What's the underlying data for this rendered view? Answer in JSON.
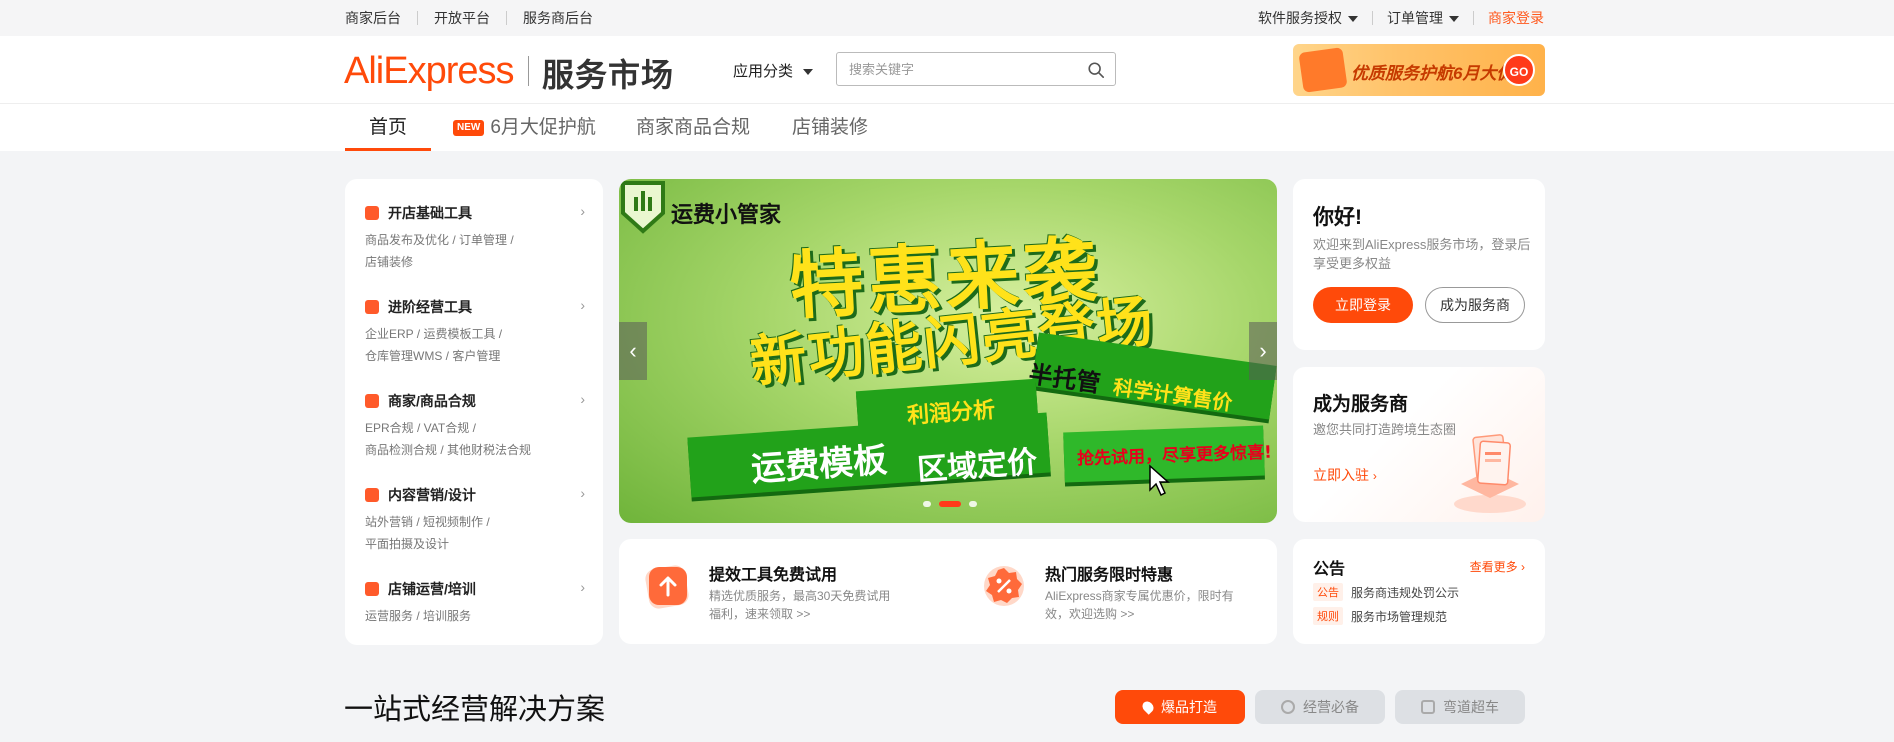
{
  "topbar": {
    "left_links": [
      "商家后台",
      "开放平台",
      "服务商后台"
    ],
    "software_auth": "软件服务授权",
    "order_mgmt": "订单管理",
    "merchant_login": "商家登录"
  },
  "header": {
    "logo_brand": "AliExpress",
    "logo_service": "服务市场",
    "category_dropdown": "应用分类",
    "search_placeholder": "搜索关键字",
    "promo_text": "优质服务护航6月大促",
    "promo_go": "GO"
  },
  "nav": {
    "tabs": [
      {
        "label": "首页",
        "active": true
      },
      {
        "label": "6月大促护航",
        "badge": "NEW"
      },
      {
        "label": "商家商品合规"
      },
      {
        "label": "店铺装修"
      }
    ]
  },
  "categories": [
    {
      "title": "开店基础工具",
      "icon": "shop-icon",
      "sub_line1": "商品发布及优化 / 订单管理 /",
      "sub_line2": "店铺装修"
    },
    {
      "title": "进阶经营工具",
      "icon": "clipboard-icon",
      "sub_line1": "企业ERP / 运费模板工具 /",
      "sub_line2": "仓库管理WMS / 客户管理"
    },
    {
      "title": "商家/商品合规",
      "icon": "diamond-icon",
      "sub_line1": "EPR合规 / VAT合规 /",
      "sub_line2": "商品检测合规 / 其他财税法合规"
    },
    {
      "title": "内容营销/设计",
      "icon": "brush-icon",
      "sub_line1": "站外营销 / 短视频制作 /",
      "sub_line2": "平面拍摄及设计"
    },
    {
      "title": "店铺运营/培训",
      "icon": "trend-icon",
      "sub_line1": "运营服务 / 培训服务",
      "sub_line2": ""
    }
  ],
  "carousel": {
    "brand": "运费小管家",
    "headline1": "特惠来袭",
    "headline2": "新功能闪亮登场",
    "tag_half": "半托管",
    "tag_sci": "科学计算售价",
    "tag_profit": "利润分析",
    "tag_freight": "运费模板",
    "tag_region": "区域定价",
    "tag_trial": "抢先试用，尽享更多惊喜!",
    "prev_arrow": "‹",
    "next_arrow": "›"
  },
  "hello_card": {
    "title": "你好!",
    "desc": "欢迎来到AliExpress服务市场，登录后享受更多权益",
    "login_btn": "立即登录",
    "provider_btn": "成为服务商"
  },
  "become_card": {
    "title": "成为服务商",
    "desc": "邀您共同打造跨境生态圈",
    "link": "立即入驻"
  },
  "features": [
    {
      "title": "提效工具免费试用",
      "desc": "精选优质服务，最高30天免费试用福利，速来领取 >>"
    },
    {
      "title": "热门服务限时特惠",
      "desc": "AliExpress商家专属优惠价，限时有效，欢迎选购 >>"
    }
  ],
  "notice": {
    "title": "公告",
    "more": "查看更多",
    "items": [
      {
        "tag": "公告",
        "text": "服务商违规处罚公示"
      },
      {
        "tag": "规则",
        "text": "服务市场管理规范"
      }
    ]
  },
  "solutions": {
    "title": "一站式经营解决方案",
    "pills": [
      "爆品打造",
      "经营必备",
      "弯道超车"
    ]
  }
}
